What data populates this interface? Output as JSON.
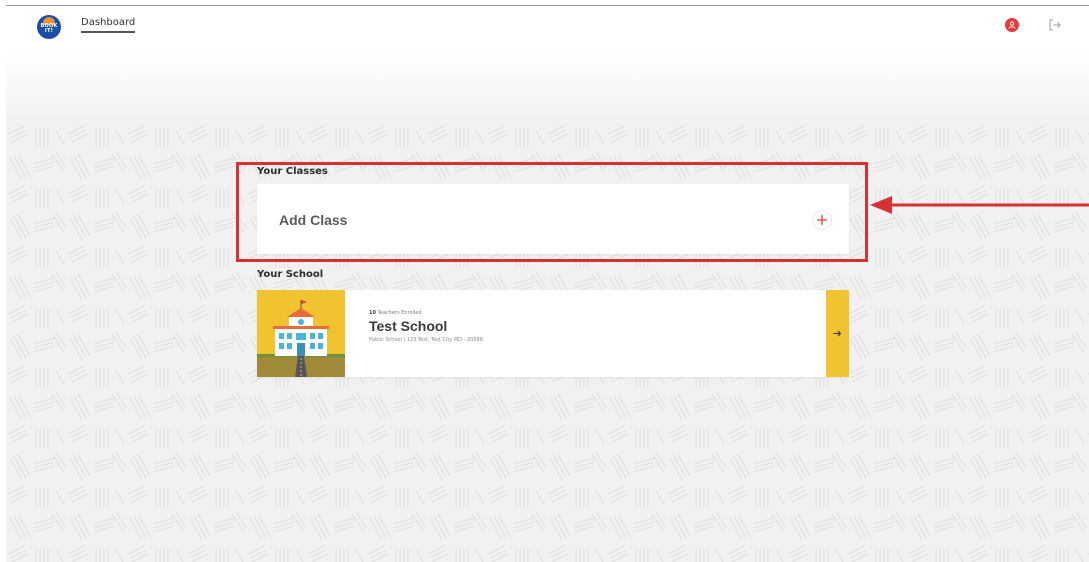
{
  "header": {
    "logo_text": "BOOK IT!",
    "nav_label": "Dashboard",
    "avatar_icon": "user-icon",
    "logout_icon": "logout-icon"
  },
  "classes": {
    "heading": "Your Classes",
    "add_label": "Add Class",
    "add_icon": "plus-icon"
  },
  "school": {
    "heading": "Your School",
    "teachers_count": "10",
    "teachers_label": "Teachers Enrolled",
    "name": "Test School",
    "details": "Public School  |  123 Test, Test City MD - 20588",
    "go_icon": "arrow-right-icon"
  },
  "colors": {
    "accent_red": "#e53b3b",
    "annotation_red": "#d93034",
    "school_yellow": "#f2c331"
  }
}
